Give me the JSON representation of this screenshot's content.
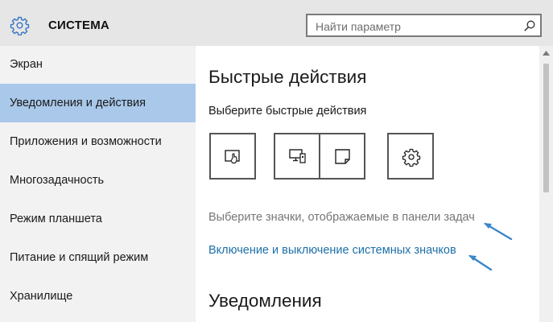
{
  "header": {
    "title": "СИСТЕМА",
    "search_placeholder": "Найти параметр"
  },
  "sidebar": {
    "items": [
      {
        "label": "Экран"
      },
      {
        "label": "Уведомления и действия",
        "active": true
      },
      {
        "label": "Приложения и возможности"
      },
      {
        "label": "Многозадачность"
      },
      {
        "label": "Режим планшета"
      },
      {
        "label": "Питание и спящий режим"
      },
      {
        "label": "Хранилище"
      }
    ]
  },
  "main": {
    "quick_actions_heading": "Быстрые действия",
    "quick_actions_subtitle": "Выберите быстрые действия",
    "tiles": [
      {
        "icon": "tablet-mode-icon"
      },
      {
        "icon": "connect-devices-icon"
      },
      {
        "icon": "note-icon"
      },
      {
        "icon": "settings-gear-icon"
      }
    ],
    "taskbar_icons_link": "Выберите значки, отображаемые в панели задач",
    "system_icons_link": "Включение и выключение системных значков",
    "notifications_heading": "Уведомления"
  },
  "colors": {
    "header_bg": "#e6e6e6",
    "sidebar_bg": "#f2f2f2",
    "active_item_bg": "#a9c8ea",
    "link_color": "#1d6fa8",
    "annotation_arrow": "#3a86c8"
  }
}
